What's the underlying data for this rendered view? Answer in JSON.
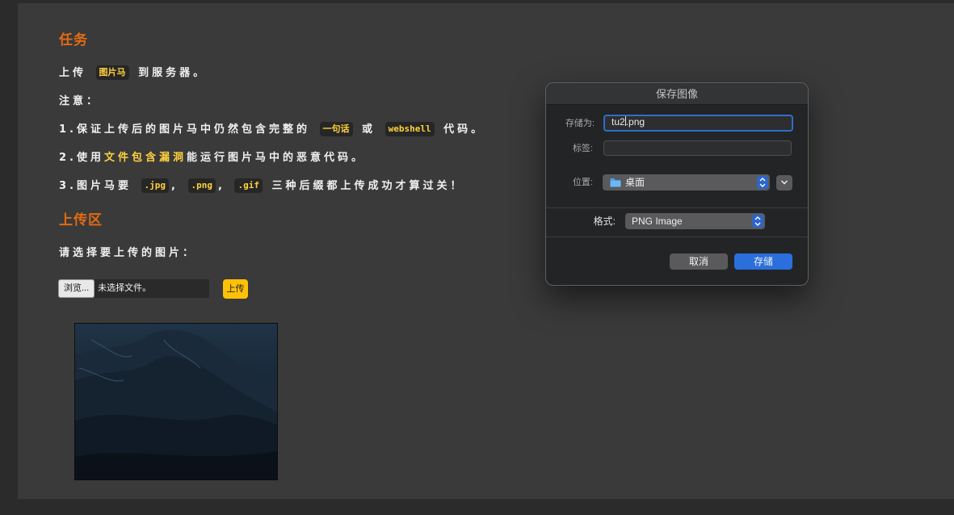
{
  "task": {
    "heading": "任务",
    "line1_before": "上传",
    "line1_code": "图片马",
    "line1_after": "到服务器。",
    "note_label": "注意：",
    "rule1_prefix": "1.保证上传后的图片马中仍然包含完整的",
    "rule1_code1": "一句话",
    "rule1_or": "或",
    "rule1_code2": "webshell",
    "rule1_suffix": "代码。",
    "rule2_prefix": "2.使用",
    "rule2_highlight": "文件包含漏洞",
    "rule2_suffix": "能运行图片马中的恶意代码。",
    "rule3_prefix": "3.图片马要",
    "rule3_ext1": ".jpg",
    "rule3_ext2": ".png",
    "rule3_ext3": ".gif",
    "comma": ",",
    "rule3_suffix": "三种后缀都上传成功才算过关！"
  },
  "upload": {
    "heading": "上传区",
    "prompt": "请选择要上传的图片：",
    "browse_label": "浏览...",
    "file_status": "未选择文件。",
    "submit_label": "上传"
  },
  "dialog": {
    "title": "保存图像",
    "save_as_label": "存储为:",
    "filename_before_caret": "tu2",
    "filename_after_caret": ".png",
    "tags_label": "标签:",
    "tags_value": "",
    "location_label": "位置:",
    "location_value": "桌面",
    "location_icon": "folder-icon",
    "format_label": "格式:",
    "format_value": "PNG Image",
    "cancel_label": "取消",
    "save_label": "存储"
  },
  "colors": {
    "accent_orange": "#e36b12",
    "highlight_yellow": "#ffd23c",
    "upload_button": "#ffc107",
    "dialog_primary": "#2a6fdb"
  }
}
